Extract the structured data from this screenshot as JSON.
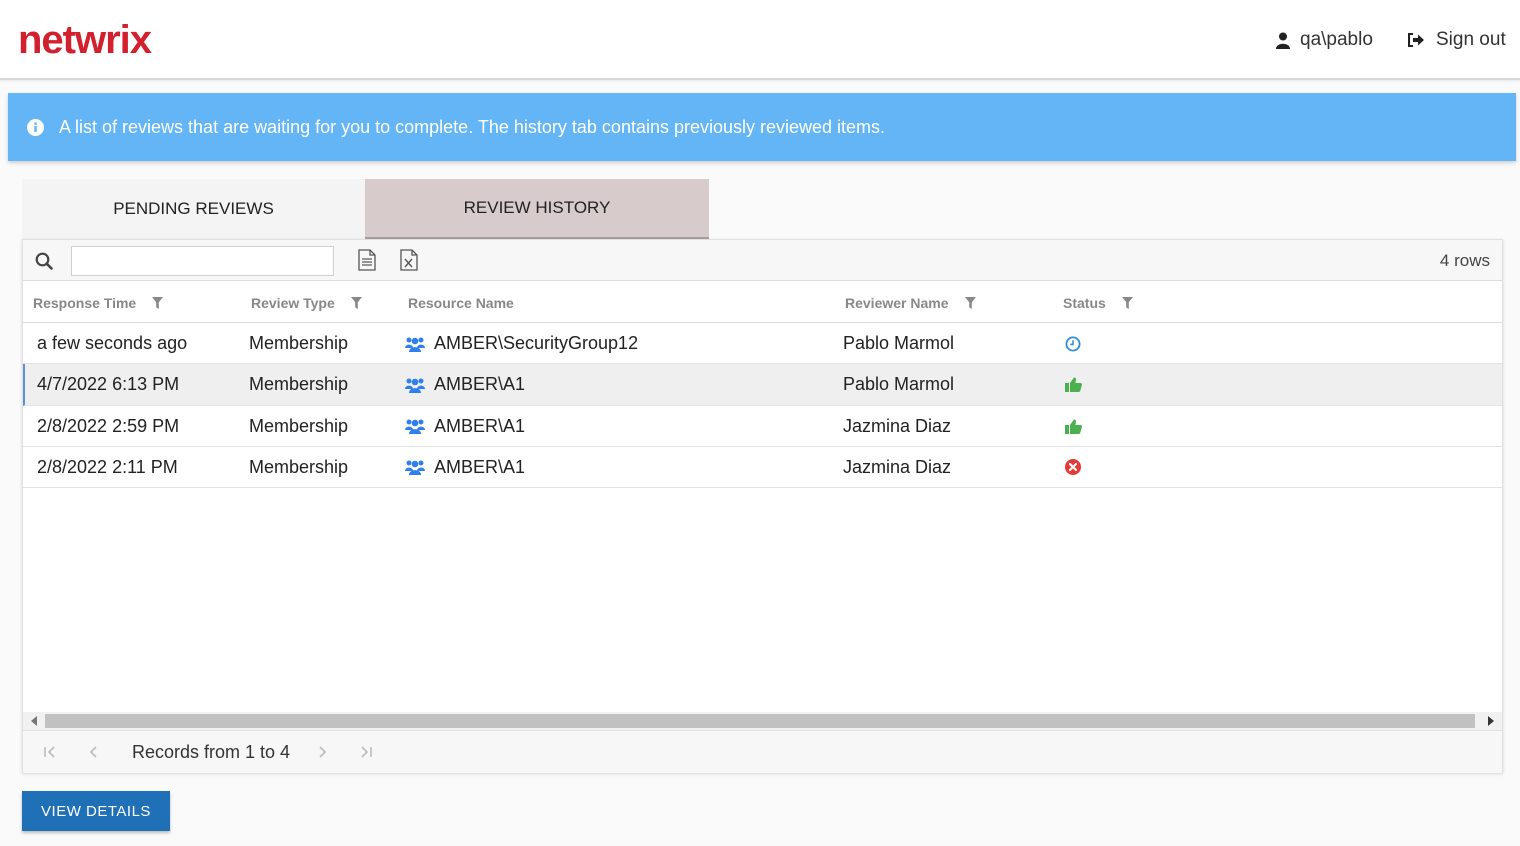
{
  "header": {
    "logo_text": "netwrix",
    "username": "qa\\pablo",
    "signout_label": "Sign out"
  },
  "banner": {
    "message": "A list of reviews that are waiting for you to complete. The history tab contains previously reviewed items."
  },
  "tabs": [
    {
      "label": "PENDING REVIEWS",
      "active": false
    },
    {
      "label": "REVIEW HISTORY",
      "active": true
    }
  ],
  "toolbar": {
    "search_value": "",
    "rows_count": "4 rows"
  },
  "columns": [
    {
      "label": "Response Time",
      "filterable": true
    },
    {
      "label": "Review Type",
      "filterable": true
    },
    {
      "label": "Resource Name",
      "filterable": false
    },
    {
      "label": "Reviewer Name",
      "filterable": true
    },
    {
      "label": "Status",
      "filterable": true
    }
  ],
  "rows": [
    {
      "response_time": "a few seconds ago",
      "review_type": "Membership",
      "resource_name": "AMBER\\SecurityGroup12",
      "reviewer_name": "Pablo Marmol",
      "status": "pending"
    },
    {
      "response_time": "4/7/2022 6:13 PM",
      "review_type": "Membership",
      "resource_name": "AMBER\\A1",
      "reviewer_name": "Pablo Marmol",
      "status": "approved"
    },
    {
      "response_time": "2/8/2022 2:59 PM",
      "review_type": "Membership",
      "resource_name": "AMBER\\A1",
      "reviewer_name": "Jazmina Diaz",
      "status": "approved"
    },
    {
      "response_time": "2/8/2022 2:11 PM",
      "review_type": "Membership",
      "resource_name": "AMBER\\A1",
      "reviewer_name": "Jazmina Diaz",
      "status": "rejected"
    }
  ],
  "pager": {
    "records_text": "Records from 1 to 4"
  },
  "actions": {
    "view_details_label": "VIEW DETAILS"
  },
  "colors": {
    "brand": "#d3202f",
    "banner": "#64b5f6",
    "active_tab": "#d7cbcb",
    "primary_button": "#1f70b6",
    "status_pending": "#2f8fd8",
    "status_approved": "#4caf50",
    "status_rejected": "#e53935",
    "group_icon": "#2f80ed"
  }
}
